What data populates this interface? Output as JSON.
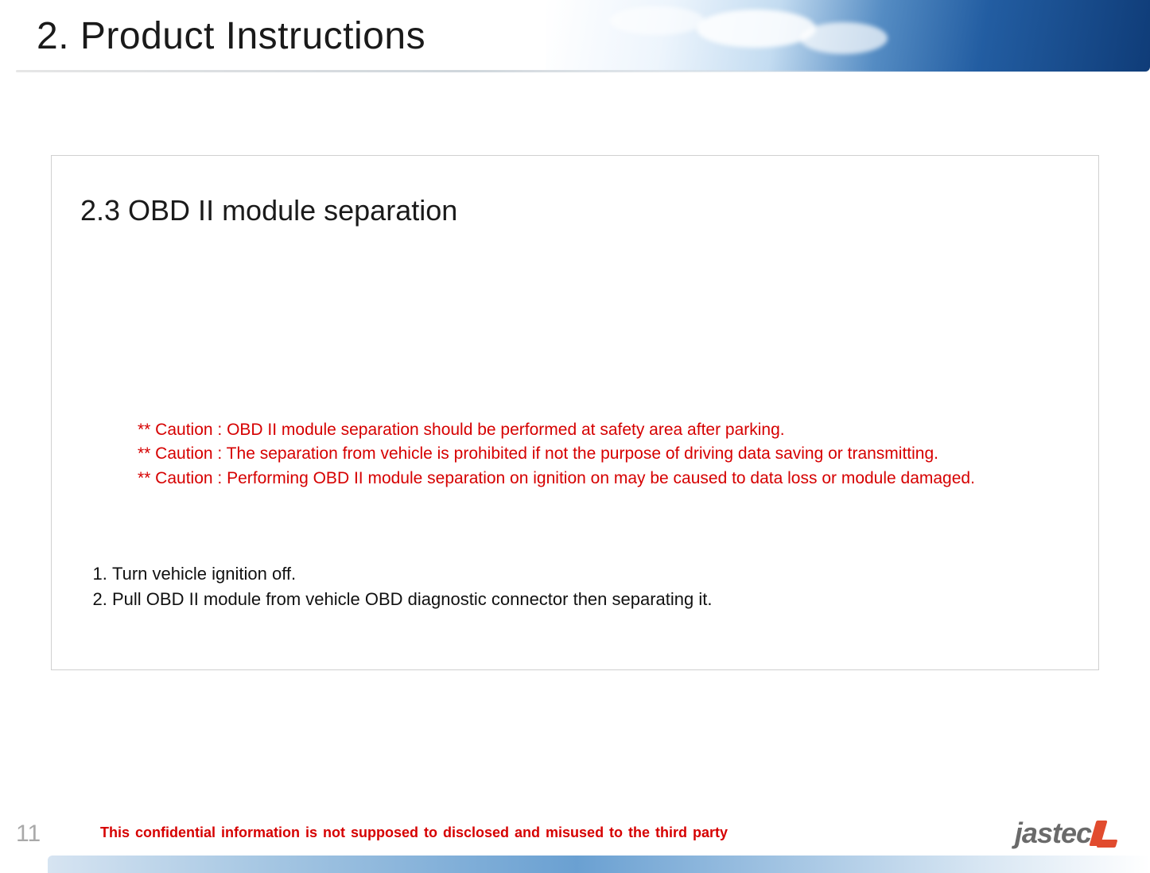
{
  "header": {
    "title": "2. Product Instructions"
  },
  "section": {
    "heading": "2.3 OBD II module separation",
    "cautions": [
      "** Caution : OBD II module separation should be performed at safety area after parking.",
      "** Caution : The separation from vehicle is prohibited if not the purpose of driving data saving or transmitting.",
      "** Caution : Performing OBD II module separation on ignition on may be caused to data loss or module damaged."
    ],
    "steps": [
      "Turn vehicle ignition off.",
      "Pull OBD II module from vehicle OBD diagnostic connector then separating it."
    ]
  },
  "footer": {
    "page_number": "11",
    "confidential": "This confidential information is not supposed to disclosed and misused to the third party",
    "logo_text": "jastec"
  }
}
